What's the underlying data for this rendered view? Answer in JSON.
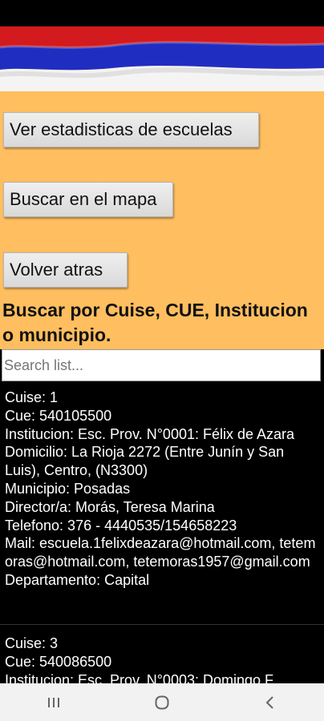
{
  "colors": {
    "panel": "#ffbe5f",
    "flag_red": "#d31a1e",
    "flag_blue": "#1f2ec1",
    "flag_white": "#ffffff"
  },
  "buttons": {
    "stats": "Ver estadisticas de escuelas",
    "map": "Buscar en el mapa",
    "back": "Volver atras"
  },
  "heading": "Buscar por Cuise, CUE, Institucion o municipio.",
  "search": {
    "placeholder": "Search list..."
  },
  "list": [
    {
      "cuise": "Cuise: 1",
      "cue": "Cue: 540105500",
      "institucion": "Institucion: Esc. Prov. N°0001: Félix de Azara",
      "domicilio": "Domicilio: La Rioja 2272 (Entre Junín y San Luis), Centro, (N3300)",
      "municipio": "Municipio: Posadas",
      "director": "Director/a: Morás, Teresa Marina",
      "telefono": "Telefono: 376 - 4440535/154658223",
      "mail": "Mail: escuela.1felixdeazara@hotmail.com, tetemoras@hotmail.com, tetemoras1957@gmail.com",
      "departamento": "Departamento: Capital"
    },
    {
      "cuise": "Cuise: 3",
      "cue": "Cue: 540086500",
      "institucion": "Institucion: Esc. Prov. N°0003: Domingo F."
    }
  ],
  "nav": {
    "recents": "recents-icon",
    "home": "home-icon",
    "back": "back-icon"
  }
}
